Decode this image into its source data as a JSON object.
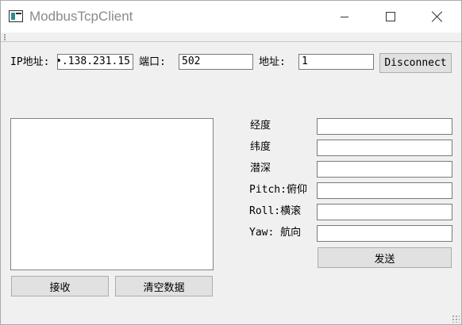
{
  "window": {
    "title": "ModbusTcpClient"
  },
  "connection": {
    "ip_label": "IP地址:",
    "ip_value": "•.138.231.15",
    "port_label": "端口:",
    "port_value": "502",
    "address_label": "地址:",
    "address_value": "1",
    "disconnect_label": "Disconnect"
  },
  "receive_area": {
    "content": "",
    "receive_button": "接收",
    "clear_button": "清空数据"
  },
  "send_form": {
    "fields": [
      {
        "label": "经度",
        "value": ""
      },
      {
        "label": "纬度",
        "value": ""
      },
      {
        "label": "潜深",
        "value": ""
      },
      {
        "label": "Pitch:俯仰",
        "value": ""
      },
      {
        "label": "Roll:横滚",
        "value": ""
      },
      {
        "label": "Yaw: 航向",
        "value": ""
      }
    ],
    "send_button": "发送"
  }
}
